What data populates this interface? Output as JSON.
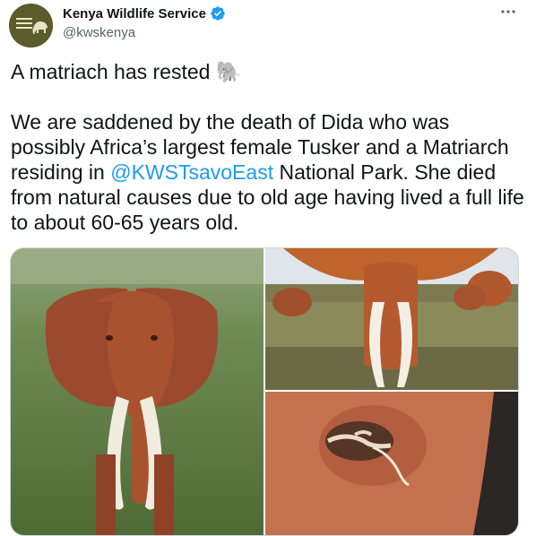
{
  "account": {
    "display_name": "Kenya Wildlife Service",
    "handle": "@kwskenya",
    "verified": true,
    "avatar_icon": "kws-logo-icon"
  },
  "menu_icon": "more-options-icon",
  "tweet": {
    "line1": "A matriach has rested",
    "line1_emoji": "🐘",
    "body_prefix": "We are saddened by the death of Dida who was possibly Africa’s largest female Tusker and a Matriarch residing in ",
    "mention": "@KWSTsavoEast",
    "body_suffix": " National Park. She died from natural causes due to old age having lived a full life to about 60-65 years old."
  },
  "media": {
    "images": [
      {
        "name": "elephant-dida-portrait-photo"
      },
      {
        "name": "elephant-herd-closeup-photo"
      },
      {
        "name": "elephant-remains-aerial-photo"
      }
    ]
  },
  "colors": {
    "link": "#1d9bf0",
    "verified": "#1d9bf0",
    "secondary_text": "#536471",
    "border": "#cfd9de"
  }
}
